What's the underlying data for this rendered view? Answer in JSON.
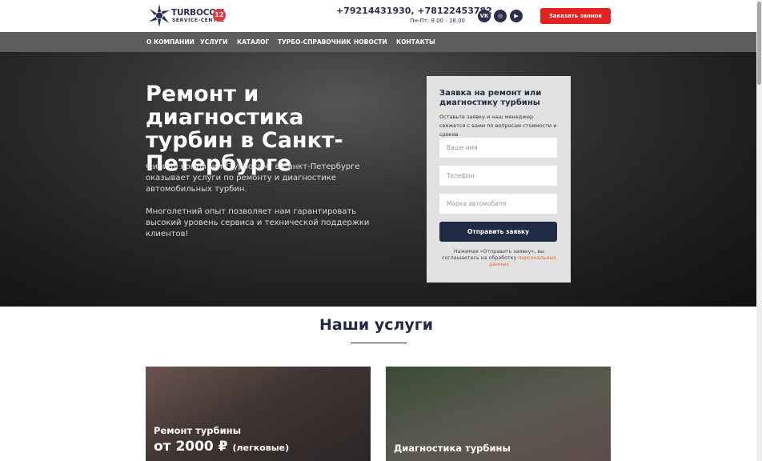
{
  "header": {
    "logo_text": "TURBOCOM",
    "logo_subtext": "SERVICE-CENTRE",
    "logo_badge": "12",
    "phones": "+79214431930, +78122453782",
    "hours": "Пн-Пт: 9.00 - 18.00",
    "social": [
      {
        "name": "vk-icon",
        "glyph": "VK"
      },
      {
        "name": "instagram-icon",
        "glyph": "◎"
      },
      {
        "name": "youtube-icon",
        "glyph": "▶"
      }
    ],
    "call_button": "Заказать звонок"
  },
  "nav": {
    "items": [
      "О КОМПАНИИ",
      "УСЛУГИ",
      "КАТАЛОГ",
      "ТУРБО-СПРАВОЧНИК",
      "НОВОСТИ",
      "КОНТАКТЫ"
    ]
  },
  "hero": {
    "title": "Ремонт и диагностика турбин в Санкт-Петербурге",
    "paragraph1": "Филиал компании \"Турбоком\" в Санкт-Петербурге оказывает услуги по ремонту и диагностике автомобильных турбин.",
    "paragraph2": "Многолетний опыт позволяет нам гарантировать высокий уровень сервиса и технической поддержки клиентов!"
  },
  "form": {
    "title": "Заявка на ремонт или диагностику турбины",
    "description": "Оставьте заявку и наш менеджер свяжется с вами по вопросам стоимости и сроков",
    "name_placeholder": "Ваше имя",
    "phone_placeholder": "Телефон",
    "car_placeholder": "Марка автомобиля",
    "submit": "Отправить заявку",
    "consent_text": "Нажимая «Отправить заявку», вы соглашаетесь на обработку ",
    "consent_link": "персональных данных"
  },
  "services": {
    "title": "Наши услуги",
    "cards": [
      {
        "title": "Ремонт турбины",
        "price": "от 2000 ₽",
        "note": "(легковые)"
      },
      {
        "title": "Диагностика турбины",
        "price": "",
        "note": ""
      }
    ]
  },
  "colors": {
    "brand_dark": "#1f2a44",
    "accent_red": "#e52222",
    "nav_bg": "#5d5d5d",
    "link_orange": "#e5663a"
  }
}
